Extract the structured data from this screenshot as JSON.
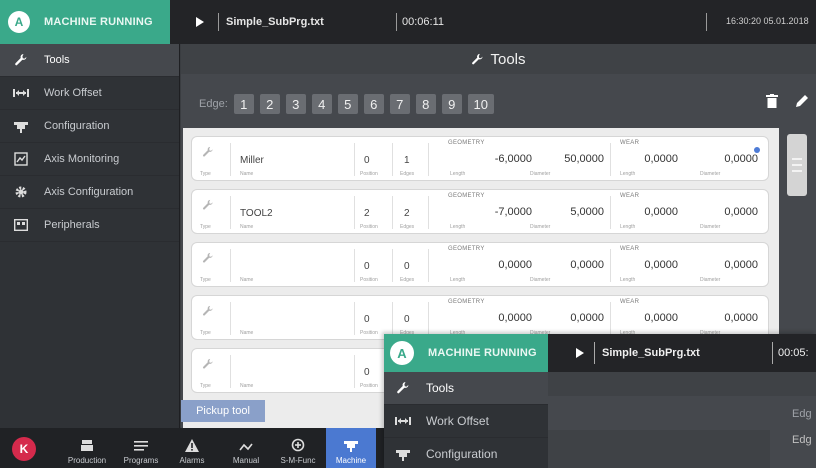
{
  "status": {
    "badge": "A",
    "text": "MACHINE RUNNING"
  },
  "topbar": {
    "program": "Simple_SubPrg.txt",
    "runtime": "00:06:11",
    "clock": "16:30:20 05.01.2018"
  },
  "sidebar": {
    "items": [
      {
        "label": "Tools",
        "icon": "wrench-icon"
      },
      {
        "label": "Work Offset",
        "icon": "work-offset-icon"
      },
      {
        "label": "Configuration",
        "icon": "spindle-icon"
      },
      {
        "label": "Axis Monitoring",
        "icon": "axis-monitor-icon"
      },
      {
        "label": "Axis Configuration",
        "icon": "gear-icon"
      },
      {
        "label": "Peripherals",
        "icon": "peripherals-icon"
      }
    ]
  },
  "content": {
    "title": "Tools",
    "edge_label": "Edge:",
    "edges": [
      "1",
      "2",
      "3",
      "4",
      "5",
      "6",
      "7",
      "8",
      "9",
      "10"
    ],
    "col": {
      "type": "Type",
      "name": "Name",
      "position": "Position",
      "edges": "Edges",
      "geometry": "GEOMETRY",
      "wear": "WEAR",
      "length": "Length",
      "diameter": "Diameter"
    },
    "rows": [
      {
        "name": "Miller",
        "position": "0",
        "edges": "1",
        "geo_length": "-6,0000",
        "geo_diameter": "50,0000",
        "wear_length": "0,0000",
        "wear_diameter": "0,0000",
        "selected": true
      },
      {
        "name": "TOOL2",
        "position": "2",
        "edges": "2",
        "geo_length": "-7,0000",
        "geo_diameter": "5,0000",
        "wear_length": "0,0000",
        "wear_diameter": "0,0000",
        "selected": false
      },
      {
        "name": "",
        "position": "0",
        "edges": "0",
        "geo_length": "0,0000",
        "geo_diameter": "0,0000",
        "wear_length": "0,0000",
        "wear_diameter": "0,0000",
        "selected": false
      },
      {
        "name": "",
        "position": "0",
        "edges": "0",
        "geo_length": "0,0000",
        "geo_diameter": "0,0000",
        "wear_length": "0,0000",
        "wear_diameter": "0,0000",
        "selected": false
      },
      {
        "name": "",
        "position": "0",
        "edges": "",
        "geo_length": "",
        "geo_diameter": "",
        "wear_length": "",
        "wear_diameter": "",
        "selected": false
      }
    ],
    "pickup_label": "Pickup tool"
  },
  "bottombar": {
    "user_initial": "K",
    "tabs": [
      {
        "label": "Production",
        "icon": "production-icon"
      },
      {
        "label": "Programs",
        "icon": "programs-icon"
      },
      {
        "label": "Alarms",
        "icon": "alarm-icon"
      },
      {
        "label": "Manual",
        "icon": "manual-icon"
      },
      {
        "label": "S-M-Func",
        "icon": "smfunc-icon"
      },
      {
        "label": "Machine",
        "icon": "machine-icon"
      }
    ]
  },
  "overlay": {
    "status_badge": "A",
    "status_text": "MACHINE RUNNING",
    "program": "Simple_SubPrg.txt",
    "runtime": "00:05:",
    "sidebar_items": [
      "Tools",
      "Work Offset",
      "Configuration"
    ],
    "edge_label": "Edg",
    "edge_label2": "Edg"
  },
  "colors": {
    "running_green": "#3aa98a",
    "accent_blue": "#4b79d1",
    "user_badge": "#d52a4c"
  }
}
